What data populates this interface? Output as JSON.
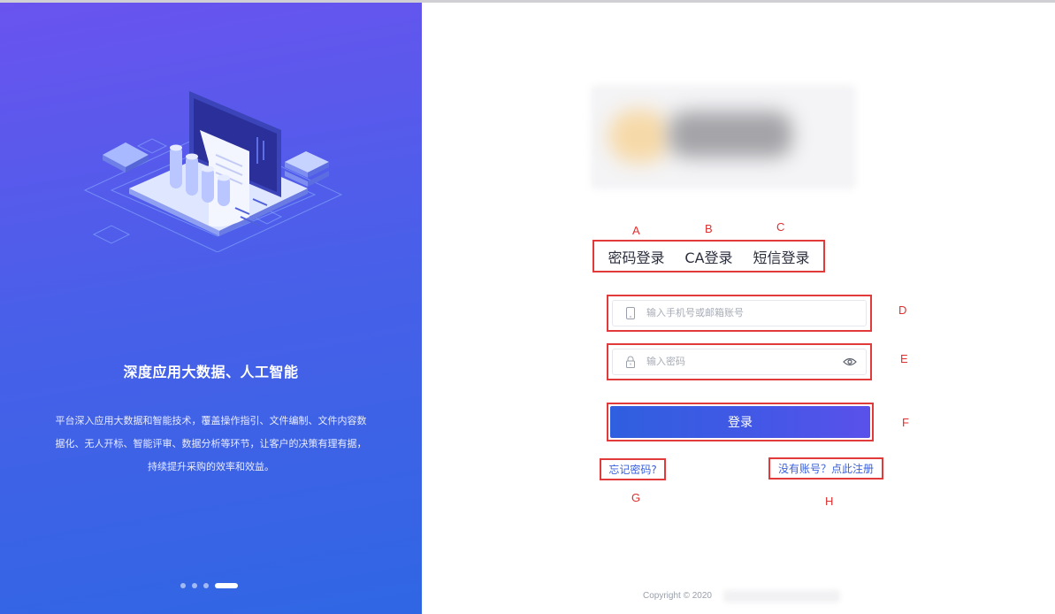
{
  "promo": {
    "slogan": "深度应用大数据、人工智能",
    "description": "平台深入应用大数据和智能技术，覆盖操作指引、文件编制、文件内容数据化、无人开标、智能评审、数据分析等环节，让客户的决策有理有据，持续提升采购的效率和效益。",
    "carousel": {
      "total": 4,
      "active_index": 3
    }
  },
  "login": {
    "tabs": [
      {
        "label": "密码登录"
      },
      {
        "label": "CA登录"
      },
      {
        "label": "短信登录"
      }
    ],
    "account_placeholder": "输入手机号或邮箱账号",
    "password_placeholder": "输入密码",
    "submit_label": "登录",
    "forgot_label": "忘记密码?",
    "register_label": "没有账号？点此注册"
  },
  "annotations": {
    "a": "A",
    "b": "B",
    "c": "C",
    "d": "D",
    "e": "E",
    "f": "F",
    "g": "G",
    "h": "H"
  },
  "footer": {
    "copyright": "Copyright © 2020"
  },
  "colors": {
    "accent": "#3a5fd9",
    "annotation": "#e03a3a",
    "panel_top": "#6a53ef",
    "panel_bottom": "#2f66e3"
  },
  "icons": {
    "account": "phone-icon",
    "password": "lock-icon",
    "toggle": "eye-icon"
  }
}
